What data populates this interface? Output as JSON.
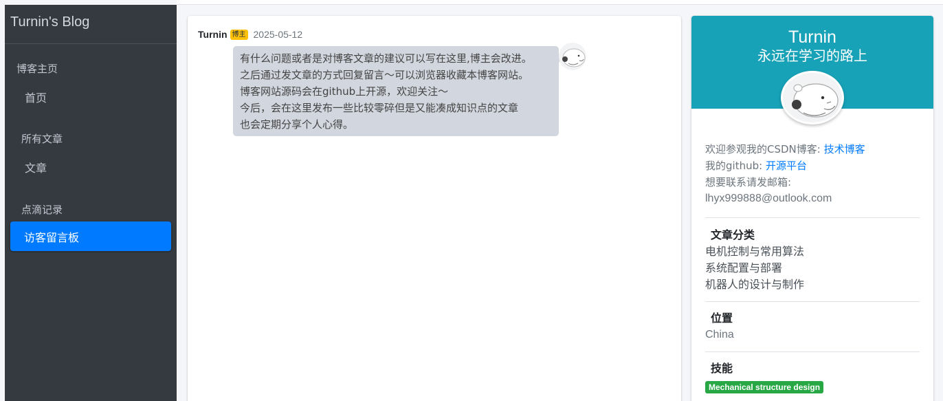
{
  "sidebar": {
    "brand": "Turnin's Blog",
    "items": [
      {
        "header": "博客主页",
        "label": "首页"
      },
      {
        "header": "所有文章",
        "label": "文章"
      },
      {
        "header": "点滴记录",
        "label": "访客留言板"
      }
    ]
  },
  "message": {
    "author": "Turnin",
    "badge": "博主",
    "date": "2025-05-12",
    "lines": [
      "有什么问题或者是对博客文章的建议可以写在这里,博主会改进。",
      "之后通过发文章的方式回复留言～可以浏览器收藏本博客网站。",
      "博客网站源码会在github上开源，欢迎关注～",
      "今后，会在这里发布一些比较零碎但是又能凑成知识点的文章",
      "也会定期分享个人心得。"
    ]
  },
  "profile": {
    "name": "Turnin",
    "motto": "永远在学习的路上",
    "csdn_label": "欢迎参观我的CSDN博客:",
    "csdn_link": "技术博客",
    "github_label": "我的github:",
    "github_link": "开源平台",
    "email_label": "想要联系请发邮箱:",
    "email": "lhyx999888@outlook.com",
    "categories_title": "文章分类",
    "categories": [
      "电机控制与常用算法",
      "系统配置与部署",
      "机器人的设计与制作"
    ],
    "location_title": "位置",
    "location": "China",
    "skills_title": "技能",
    "skills": [
      "Mechanical structure design"
    ]
  },
  "colors": {
    "sidebar": "#343a40",
    "active": "#007bff",
    "profile_header": "#17a2b8",
    "badge": "#ffc107",
    "skill": "#28a745",
    "link": "#007bff"
  }
}
